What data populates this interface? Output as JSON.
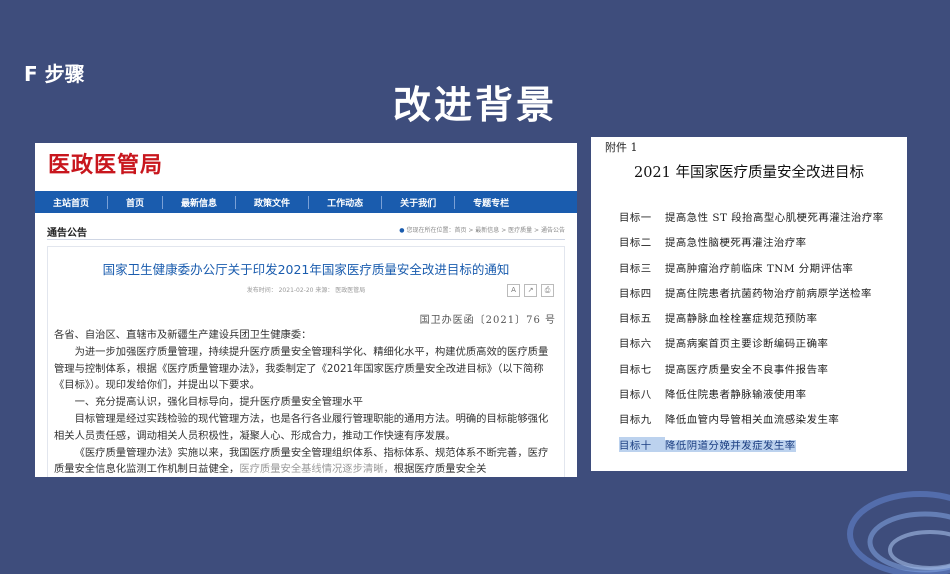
{
  "slide": {
    "step": "F 步骤",
    "title": "改进背景"
  },
  "left_panel": {
    "site_logo": "医政医管局",
    "nav": [
      "主站首页",
      "首页",
      "最新信息",
      "政策文件",
      "工作动态",
      "关于我们",
      "专题专栏"
    ],
    "section_label": "通告公告",
    "breadcrumb": "您现在所在位置：首页 > 最新信息 > 医疗质量 > 通告公告",
    "article_title": "国家卫生健康委办公厅关于印发2021年国家医疗质量安全改进目标的通知",
    "meta": "发布时间： 2021-02-20    来源： 医政医管局",
    "doc_number": "国卫办医函〔2021〕76 号",
    "paragraphs": [
      "各省、自治区、直辖市及新疆生产建设兵团卫生健康委：",
      "为进一步加强医疗质量管理，持续提升医疗质量安全管理科学化、精细化水平，构建优质高效的医疗质量管理与控制体系，根据《医疗质量管理办法》，我委制定了《2021年国家医疗质量安全改进目标》（以下简称《目标》）。现印发给你们，并提出以下要求。",
      "一、充分提高认识，强化目标导向，提升医疗质量安全管理水平",
      "目标管理是经过实践检验的现代管理方法，也是各行各业履行管理职能的通用方法。明确的目标能够强化相关人员责任感，调动相关人员积极性，凝聚人心、形成合力，推动工作快速有序发展。",
      "《医疗质量管理办法》实施以来，我国医疗质量安全管理组织体系、指标体系、规范体系不断完善，医疗质量安全信息化监测工作机制日益健全，"
    ],
    "faded_tail": "医疗质量安全基线情况逐步清晰，",
    "last_tail": "根据医疗质量安全关"
  },
  "right_panel": {
    "attachment": "附件 1",
    "title": "2021 年国家医疗质量安全改进目标",
    "goals": [
      {
        "label": "目标一",
        "text": "提高急性 ST 段抬高型心肌梗死再灌注治疗率"
      },
      {
        "label": "目标二",
        "text": "提高急性脑梗死再灌注治疗率"
      },
      {
        "label": "目标三",
        "text": "提高肿瘤治疗前临床 TNM 分期评估率"
      },
      {
        "label": "目标四",
        "text": "提高住院患者抗菌药物治疗前病原学送检率"
      },
      {
        "label": "目标五",
        "text": "提高静脉血栓栓塞症规范预防率"
      },
      {
        "label": "目标六",
        "text": "提高病案首页主要诊断编码正确率"
      },
      {
        "label": "目标七",
        "text": "提高医疗质量安全不良事件报告率"
      },
      {
        "label": "目标八",
        "text": "降低住院患者静脉输液使用率"
      },
      {
        "label": "目标九",
        "text": "降低血管内导管相关血流感染发生率"
      },
      {
        "label": "目标十",
        "text": "降低阴道分娩并发症发生率",
        "selected": true
      }
    ]
  }
}
